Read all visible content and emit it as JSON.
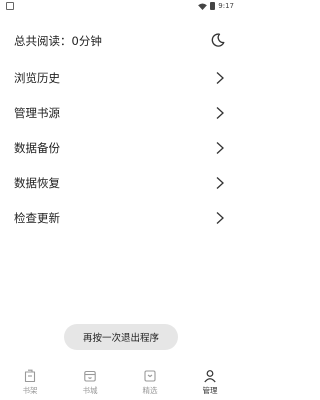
{
  "status_bar": {
    "time": "9:17"
  },
  "header": {
    "total_read": "总共阅读：0分钟",
    "theme_icon": "moon-icon"
  },
  "menu": {
    "items": [
      {
        "label": "浏览历史"
      },
      {
        "label": "管理书源"
      },
      {
        "label": "数据备份"
      },
      {
        "label": "数据恢复"
      },
      {
        "label": "检查更新"
      }
    ]
  },
  "toast": {
    "text": "再按一次退出程序"
  },
  "tabbar": {
    "tabs": [
      {
        "label": "书架",
        "icon": "bookshelf-icon",
        "active": false
      },
      {
        "label": "书城",
        "icon": "bookstore-icon",
        "active": false
      },
      {
        "label": "精选",
        "icon": "featured-icon",
        "active": false
      },
      {
        "label": "管理",
        "icon": "manage-icon",
        "active": true
      }
    ]
  },
  "colors": {
    "text": "#222222",
    "inactive_tab": "#999999",
    "toast_bg": "#e6e6e6"
  }
}
